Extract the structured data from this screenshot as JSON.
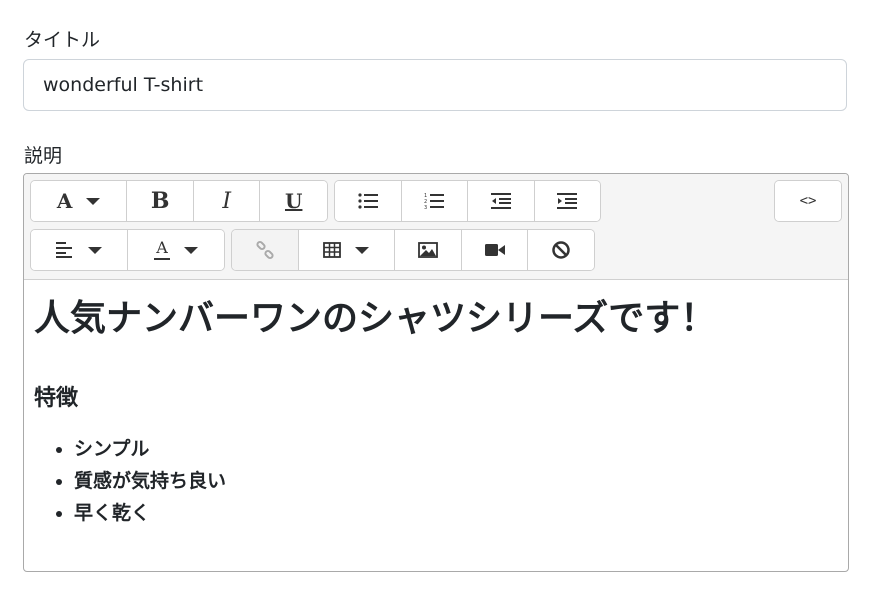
{
  "form": {
    "title_label": "タイトル",
    "title_value": "wonderful T-shirt",
    "description_label": "説明"
  },
  "toolbar": {
    "row1": [
      "font-style-dropdown",
      "bold",
      "italic",
      "underline",
      "unordered-list",
      "ordered-list",
      "outdent",
      "indent"
    ],
    "row2": [
      "paragraph-align-dropdown",
      "font-color-dropdown",
      "link",
      "table-dropdown",
      "picture",
      "video",
      "clear-format"
    ],
    "bold_glyph": "B",
    "italic_glyph": "I",
    "underline_glyph": "U",
    "font_glyph": "A",
    "color_glyph": "A",
    "code_view_glyph": "<>",
    "link_disabled": true
  },
  "content": {
    "heading": "人気ナンバーワンのシャツシリーズです！",
    "subheading": "特徴",
    "features": [
      "シンプル",
      "質感が気持ち良い",
      "早く乾く"
    ]
  }
}
